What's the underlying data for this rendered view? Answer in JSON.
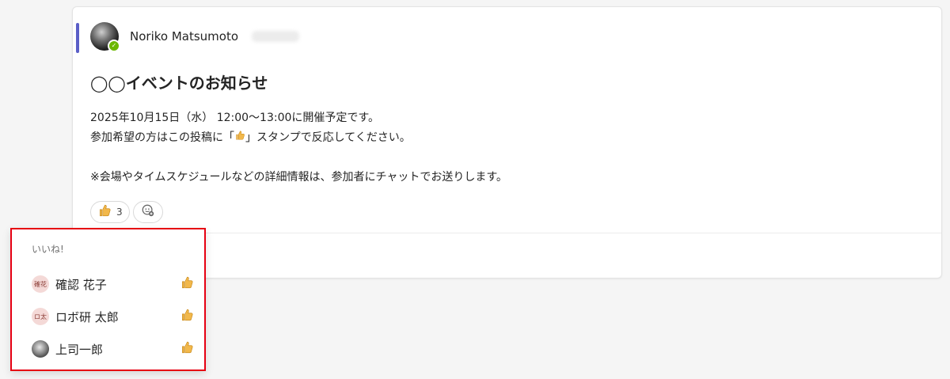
{
  "post": {
    "author_name": "Noriko Matsumoto",
    "title": "◯◯イベントのお知らせ",
    "body_line1": "2025年10月15日（水） 12:00〜13:00に開催予定です。",
    "body_line2_prefix": "参加希望の方はこの投稿に「",
    "body_line2_suffix": "」スタンプで反応してください。",
    "body_line3": "※会場やタイムスケジュールなどの詳細情報は、参加者にチャットでお送りします。",
    "reaction": {
      "icon": "thumbs-up-icon",
      "count": "3"
    },
    "add_reaction_icon": "add-emoji-icon"
  },
  "popup": {
    "title": "いいね!",
    "people": [
      {
        "avatar_text": "確花",
        "name": "確認 花子",
        "icon": "thumbs-up-icon"
      },
      {
        "avatar_text": "ロ太",
        "name": "ロボ研 太郎",
        "icon": "thumbs-up-icon"
      },
      {
        "avatar_text": "",
        "name": "上司一郎",
        "icon": "thumbs-up-icon"
      }
    ]
  },
  "colors": {
    "accent": "#5b5fc7",
    "highlight_border": "#e60012",
    "presence": "#6bb700",
    "thumb": "#f2b84b"
  }
}
